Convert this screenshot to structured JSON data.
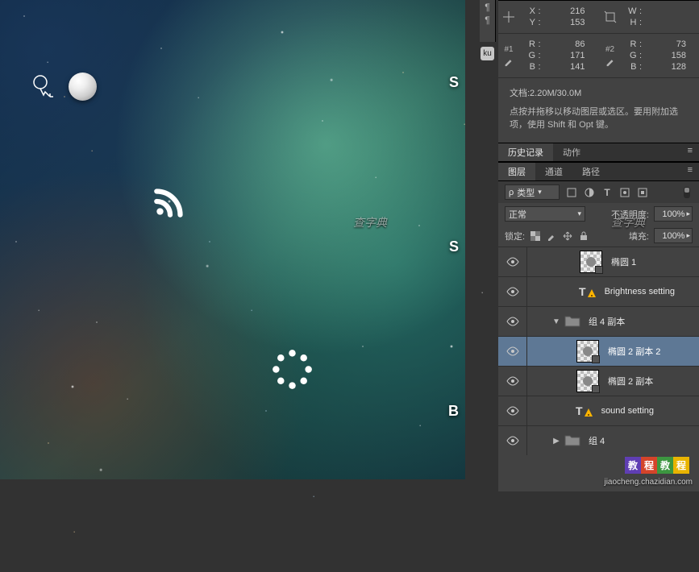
{
  "info": {
    "pos_label_x": "X",
    "pos_label_y": "Y",
    "pos_x": "216",
    "pos_y": "153",
    "size_label_w": "W",
    "size_label_h": "H",
    "size_w": "",
    "size_h": "",
    "swatch1": {
      "tag": "#1",
      "r_label": "R",
      "g_label": "G",
      "b_label": "B",
      "r": "86",
      "g": "171",
      "b": "141"
    },
    "swatch2": {
      "tag": "#2",
      "r_label": "R",
      "g_label": "G",
      "b_label": "B",
      "r": "73",
      "g": "158",
      "b": "128"
    },
    "doc_size": "文档:2.20M/30.0M",
    "hint": "点按并拖移以移动图层或选区。要用附加选项，使用 Shift 和 Opt 键。"
  },
  "tabs_upper": {
    "history": "历史记录",
    "actions": "动作"
  },
  "tabs_lower": {
    "layers": "图层",
    "channels": "通道",
    "paths": "路径"
  },
  "filter": {
    "label": "类型",
    "search_glyph": "ρ"
  },
  "blend": {
    "mode": "正常",
    "opacity_label": "不透明度:",
    "opacity_value": "100%"
  },
  "lock": {
    "label": "锁定:",
    "fill_label": "填充:",
    "fill_value": "100%"
  },
  "layers": [
    {
      "name": "椭圆 1",
      "indent": 60,
      "kind": "shape",
      "sel": false
    },
    {
      "name": "Brightness setting",
      "indent": 60,
      "kind": "text",
      "sel": false
    },
    {
      "name": "组 4 副本",
      "indent": 30,
      "kind": "group",
      "sel": false,
      "open": true
    },
    {
      "name": "椭圆 2 副本 2",
      "indent": 56,
      "kind": "shape",
      "sel": true
    },
    {
      "name": "椭圆 2 副本",
      "indent": 56,
      "kind": "shape",
      "sel": false
    },
    {
      "name": "sound setting",
      "indent": 56,
      "kind": "text",
      "sel": false
    },
    {
      "name": "组 4",
      "indent": 30,
      "kind": "group",
      "sel": false,
      "open": false
    }
  ],
  "canvas_letters": {
    "s1": "S",
    "s2": "S",
    "b": "B"
  },
  "toolstrip": {
    "ku": "ku"
  },
  "watermark": {
    "text": "查字典",
    "credit": "jiaocheng.chazidian.com",
    "badge": [
      "教",
      "程",
      "教",
      "程"
    ]
  }
}
